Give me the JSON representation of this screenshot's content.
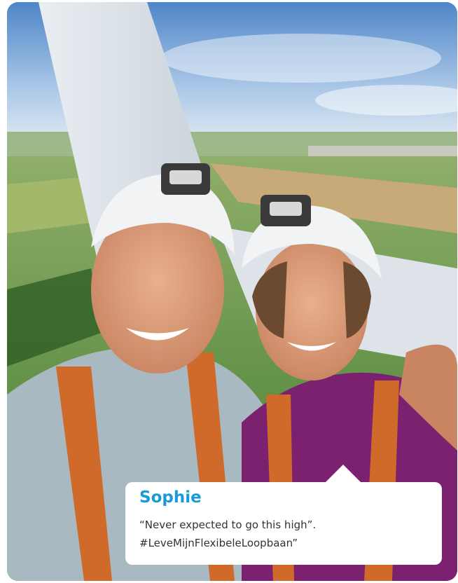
{
  "photo": {
    "description_icon": "selfie-photo",
    "sky_color": "#7ea6d6",
    "field_color": "#5e9a3a",
    "helmet_color": "#f2f2f2",
    "shirt_left_color": "#a8b8c0",
    "shirt_right_color": "#7a1f6e"
  },
  "card": {
    "name": "Sophie",
    "quote_line1": "“Never expected to go this high”.",
    "quote_line2": "#LeveMijnFlexibeleLoopbaan”",
    "name_color": "#1a9ad6"
  }
}
